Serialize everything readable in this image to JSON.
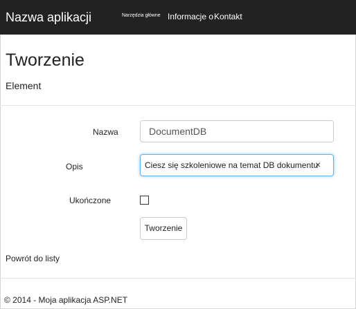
{
  "navbar": {
    "brand": "Nazwa aplikacji",
    "links": {
      "home": "Narzędzia główne",
      "about": "Informacje o",
      "contact": "Kontakt"
    }
  },
  "page": {
    "title": "Tworzenie",
    "subtitle": "Element"
  },
  "form": {
    "name": {
      "label": "Nazwa",
      "value": "DocumentDB"
    },
    "description": {
      "label": "Opis",
      "value": "Ciesz się szkoleniowe na temat DB dokumentu",
      "clear_icon": "×"
    },
    "completed": {
      "label": "Ukończone",
      "checked": false
    },
    "submit_label": "Tworzenie"
  },
  "back_link": "Powrót do listy",
  "footer": {
    "text": "© 2014 - Moja aplikacja ASP.NET"
  },
  "icons": {
    "clear": "close-icon"
  },
  "colors": {
    "navbar_background": "#222222",
    "focus_border": "#66afe9",
    "input_border": "#cccccc"
  }
}
